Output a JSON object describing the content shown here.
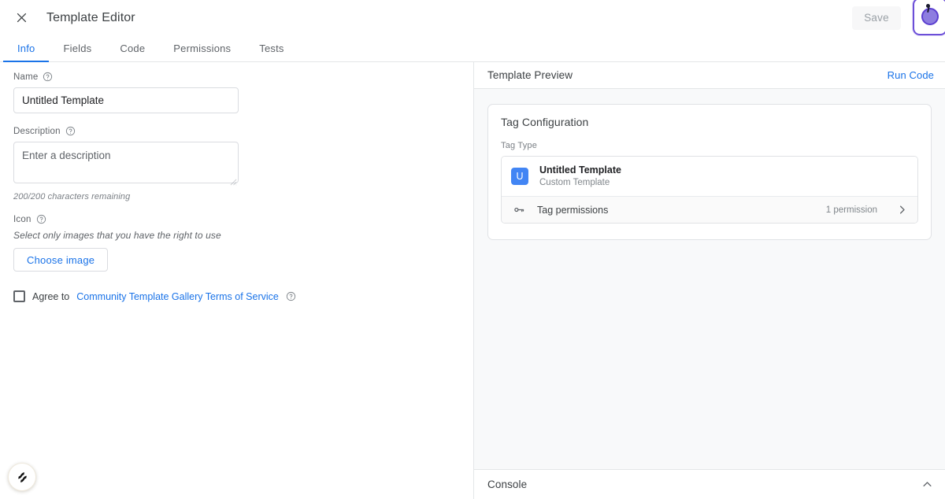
{
  "topbar": {
    "close_icon": "close-icon",
    "title": "Template Editor",
    "save_label": "Save"
  },
  "tabs": [
    {
      "label": "Info",
      "active": true
    },
    {
      "label": "Fields",
      "active": false
    },
    {
      "label": "Code",
      "active": false
    },
    {
      "label": "Permissions",
      "active": false
    },
    {
      "label": "Tests",
      "active": false
    }
  ],
  "form": {
    "name": {
      "label": "Name",
      "value": "Untitled Template",
      "placeholder": "Untitled Template",
      "help_icon": "help-icon"
    },
    "description": {
      "label": "Description",
      "value": "",
      "placeholder": "Enter a description",
      "counter": "200/200 characters remaining",
      "help_icon": "help-icon"
    },
    "icon": {
      "label": "Icon",
      "hint": "Select only images that you have the right to use",
      "choose_button": "Choose image",
      "help_icon": "help-icon"
    },
    "agree": {
      "prefix": "Agree to",
      "link": "Community Template Gallery Terms of Service",
      "checked": false,
      "help_icon": "help-icon"
    }
  },
  "preview": {
    "header_title": "Template Preview",
    "run_code_label": "Run Code",
    "card": {
      "title": "Tag Configuration",
      "tag_type_label": "Tag Type",
      "tag_type": {
        "badge": "U",
        "name": "Untitled Template",
        "subtitle": "Custom Template"
      },
      "permissions": {
        "icon": "key-icon",
        "label": "Tag permissions",
        "count": "1 permission",
        "chevron": "chevron-right-icon"
      }
    }
  },
  "console": {
    "title": "Console",
    "collapse_icon": "chevron-up-icon"
  },
  "fab": {
    "icon": "assistant-icon"
  },
  "colors": {
    "accent_blue": "#1a73e8",
    "badge_blue": "#4285f4",
    "cursor_purple": "#6c4fd8",
    "text_primary": "#202124",
    "text_secondary": "#5f6368",
    "panel_bg": "#f8f9fa",
    "border": "#e4e6e8"
  }
}
